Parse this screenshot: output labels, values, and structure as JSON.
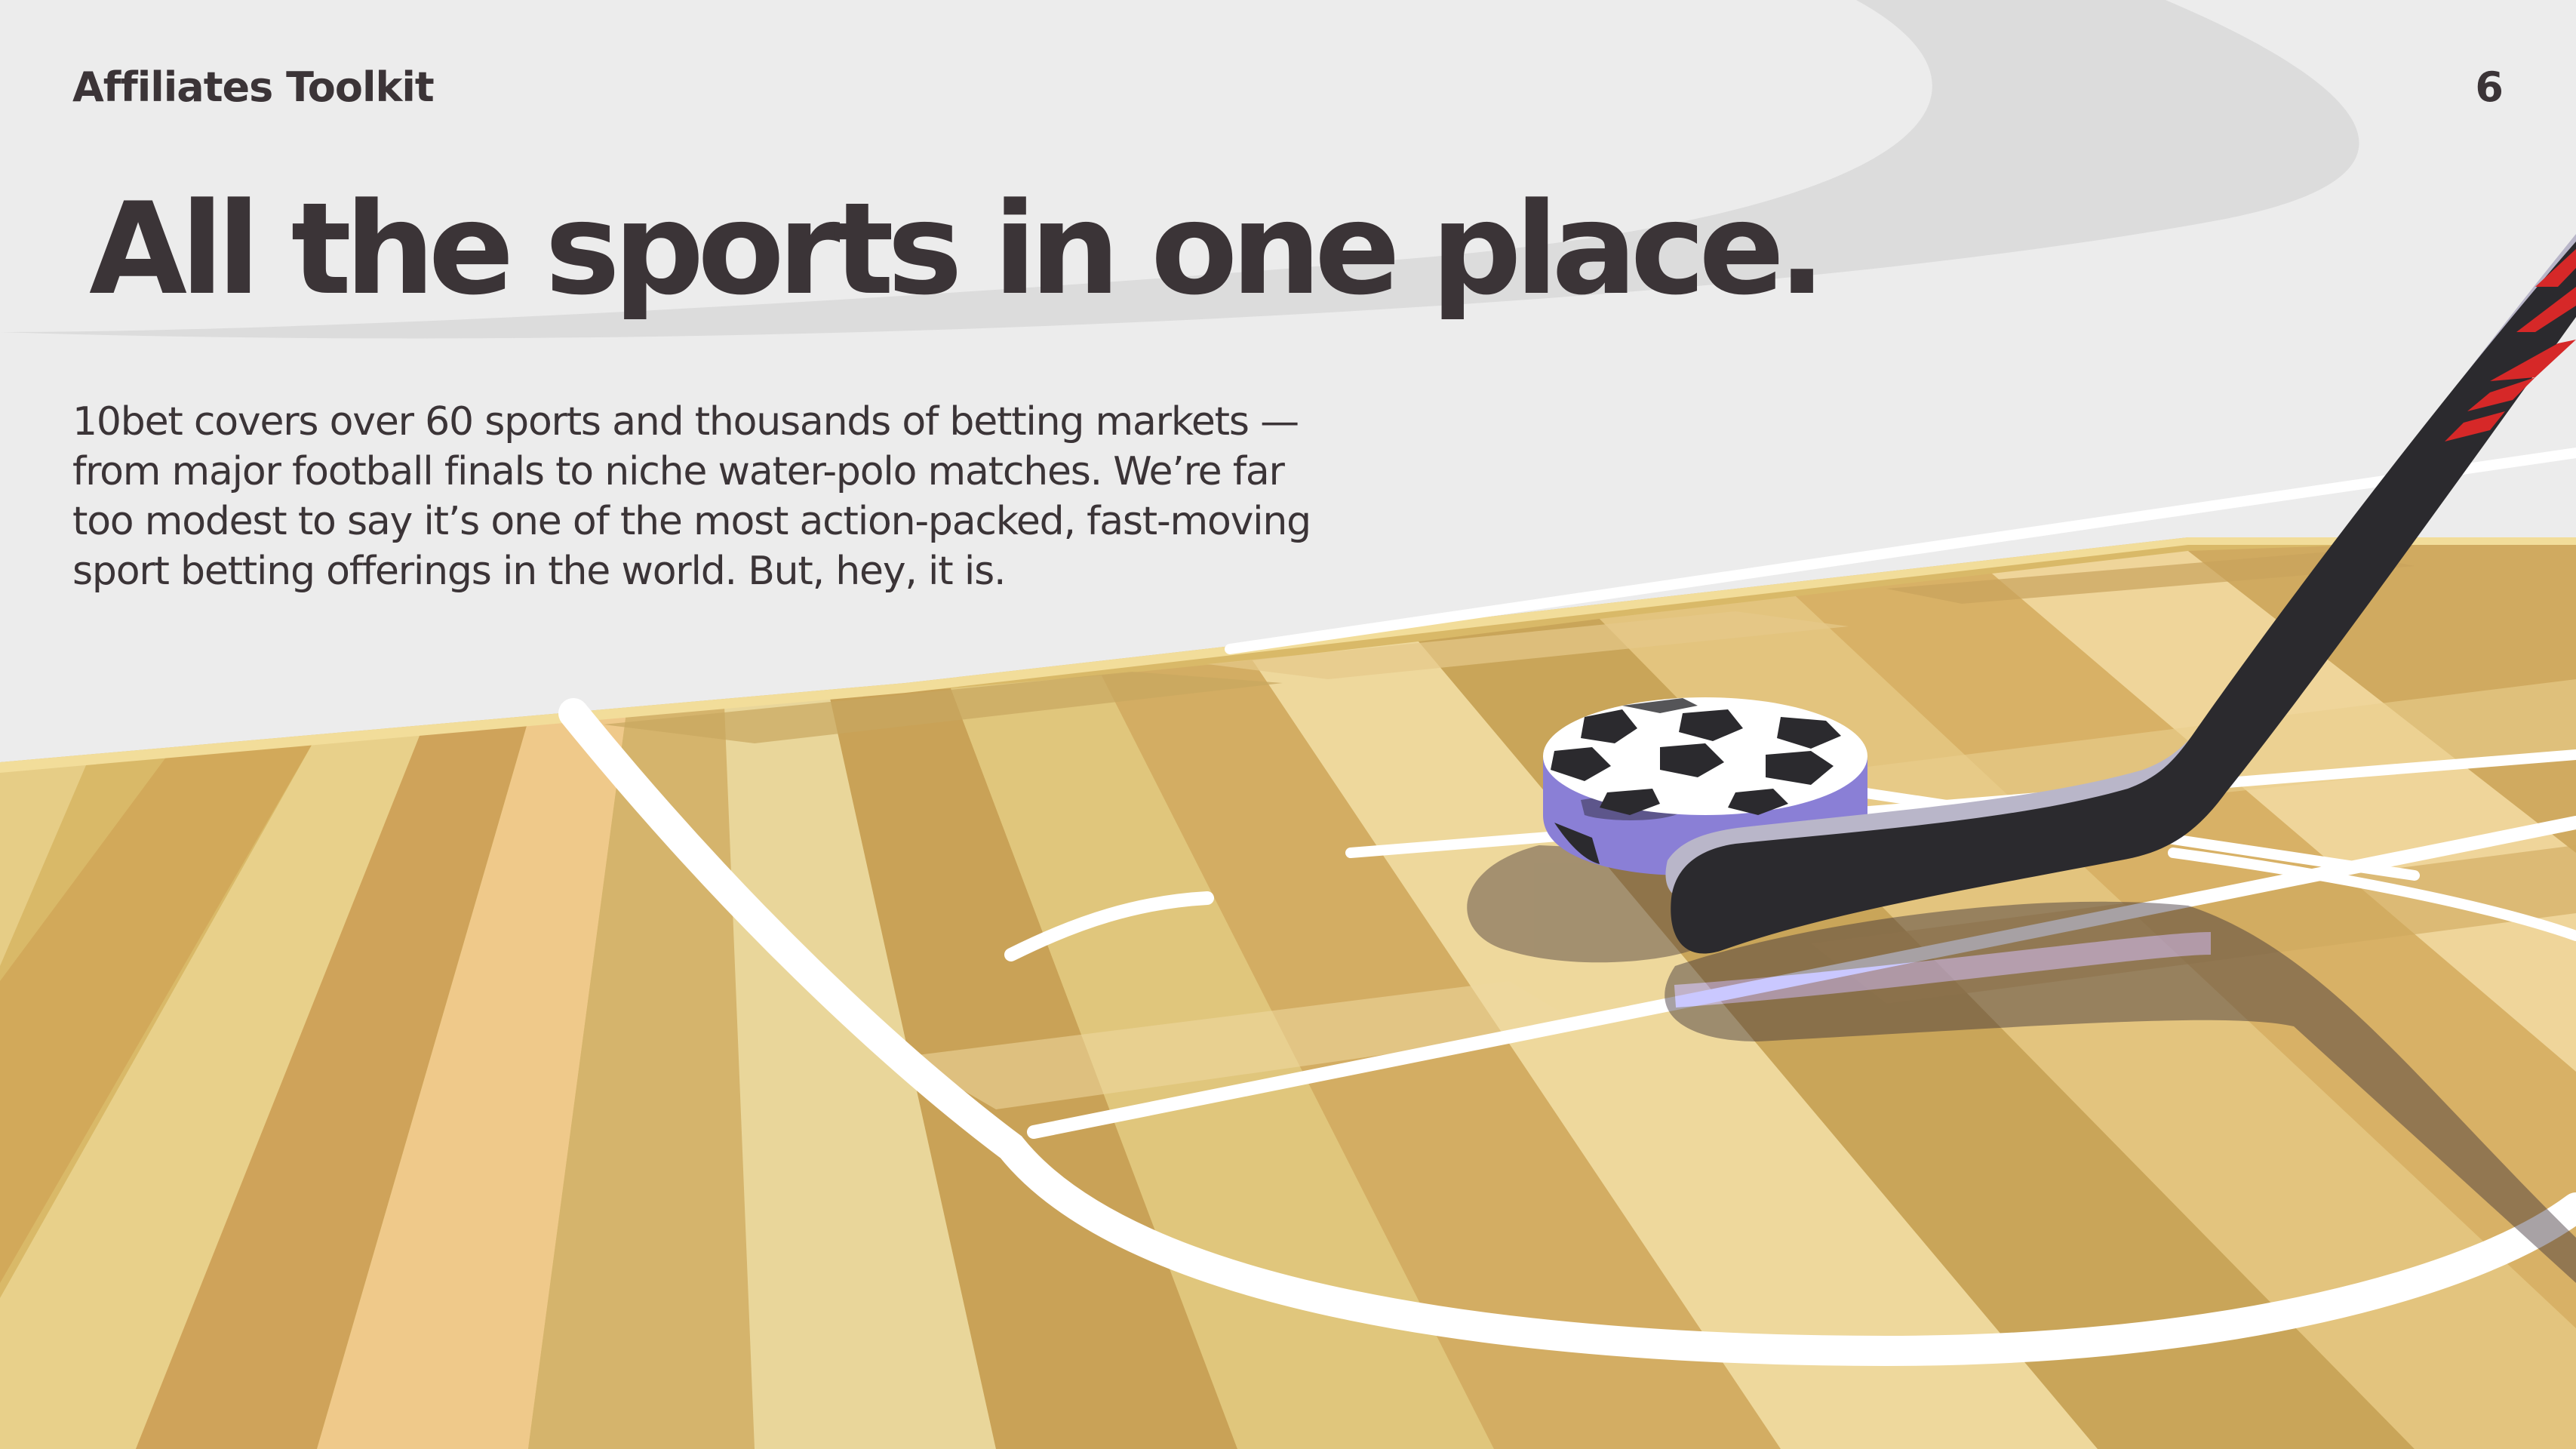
{
  "header": {
    "brand": "Affiliates Toolkit",
    "page_number": "6"
  },
  "hero": {
    "title": "All the sports in one place.",
    "body": "10bet covers over 60 sports and thousands of betting markets — from major football finals to niche water-polo matches. We’re far too modest to say it’s one of the most action-packed, fast-moving sport betting offerings in the world. But, hey, it is."
  },
  "illustration": {
    "subject": "hockey stick hitting a soccer-ball-patterned puck on a wooden court",
    "colors": {
      "background": "#ececec",
      "arc": "#dcdcdc",
      "floor": "#d9b968",
      "lines": "#ffffff",
      "puck_side": "#8a7fd6",
      "stick": "#2b2a2e",
      "stick_tape": "#d62828",
      "text": "#3b3437"
    }
  }
}
